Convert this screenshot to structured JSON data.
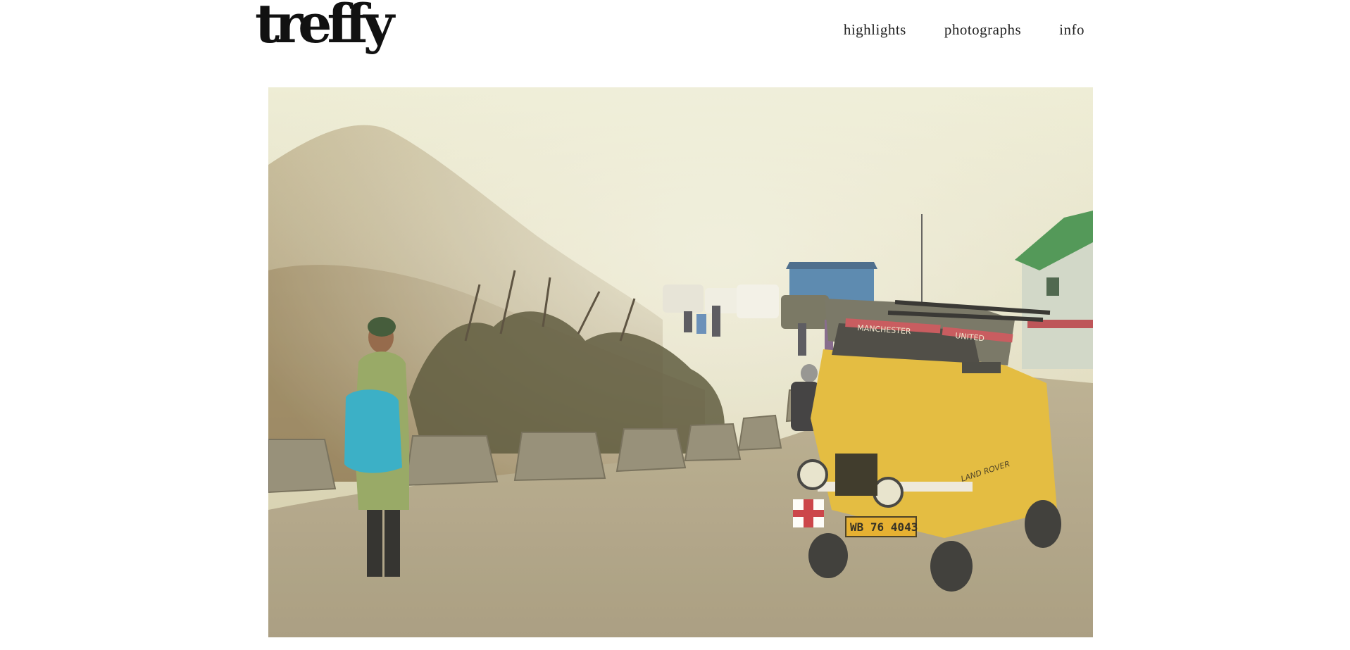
{
  "site": {
    "logo": "treffy"
  },
  "nav": {
    "items": [
      {
        "label": "highlights"
      },
      {
        "label": "photographs"
      },
      {
        "label": "info"
      }
    ]
  },
  "photo": {
    "plate_text": "WB 76 4043",
    "banner_left": "MANCHESTER",
    "banner_right": "UNITED",
    "side_text": "LAND ROVER"
  }
}
